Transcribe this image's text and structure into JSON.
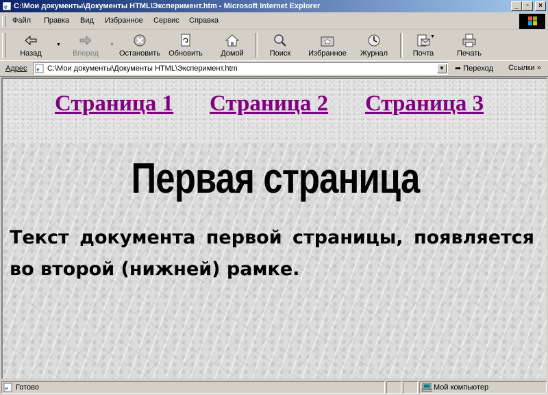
{
  "window": {
    "title": "C:\\Мои документы\\Документы HTML\\Эксперимент.htm - Microsoft Internet Explorer",
    "controls": {
      "minimize": "_",
      "restore": "▫",
      "close": "×"
    }
  },
  "menu": {
    "items": [
      "Файл",
      "Правка",
      "Вид",
      "Избранное",
      "Сервис",
      "Справка"
    ]
  },
  "toolbar": {
    "back": "Назад",
    "forward": "Вперед",
    "stop": "Остановить",
    "refresh": "Обновить",
    "home": "Домой",
    "search": "Поиск",
    "favorites": "Избранное",
    "history": "Журнал",
    "mail": "Почта",
    "print": "Печать"
  },
  "address": {
    "label": "Адрес",
    "value": "C:\\Мои документы\\Документы HTML\\Эксперимент.htm",
    "go": "Переход",
    "links": "Ссылки",
    "more": "»"
  },
  "content": {
    "nav": [
      "Страница 1",
      "Страница 2",
      "Страница 3"
    ],
    "heading": "Первая страница",
    "text": "Текст документа первой страницы, появляется во второй (нижней) рамке.",
    "link_color": "#800080"
  },
  "status": {
    "text": "Готово",
    "zone": "Мой компьютер"
  }
}
